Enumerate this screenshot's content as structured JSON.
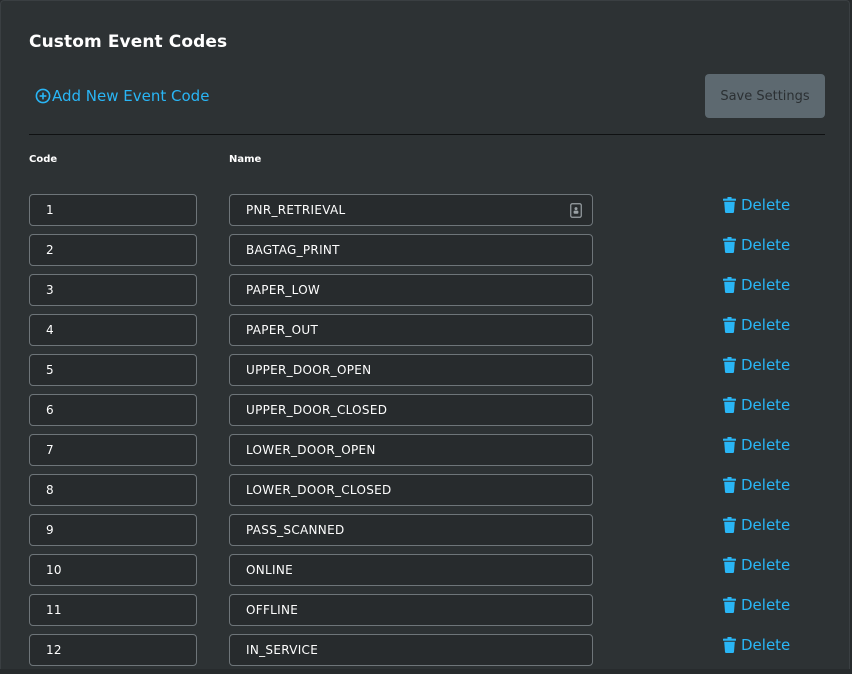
{
  "header": {
    "title": "Custom Event Codes",
    "add_label": "Add New Event Code",
    "save_label": "Save Settings"
  },
  "columns": {
    "code": "Code",
    "name": "Name"
  },
  "delete_label": "Delete",
  "colors": {
    "accent": "#29b6f6",
    "background": "#2d3234",
    "field_background": "#272b2d",
    "field_border": "#6e7579",
    "button_disabled": "#5d6970"
  },
  "icons": {
    "add": "plus-circle-icon",
    "delete": "trash-icon",
    "autofill": "contact-card-icon"
  },
  "rows": [
    {
      "code": "1",
      "name": "PNR_RETRIEVAL"
    },
    {
      "code": "2",
      "name": "BAGTAG_PRINT"
    },
    {
      "code": "3",
      "name": "PAPER_LOW"
    },
    {
      "code": "4",
      "name": "PAPER_OUT"
    },
    {
      "code": "5",
      "name": "UPPER_DOOR_OPEN"
    },
    {
      "code": "6",
      "name": "UPPER_DOOR_CLOSED"
    },
    {
      "code": "7",
      "name": "LOWER_DOOR_OPEN"
    },
    {
      "code": "8",
      "name": "LOWER_DOOR_CLOSED"
    },
    {
      "code": "9",
      "name": "PASS_SCANNED"
    },
    {
      "code": "10",
      "name": "ONLINE"
    },
    {
      "code": "11",
      "name": "OFFLINE"
    },
    {
      "code": "12",
      "name": "IN_SERVICE"
    }
  ]
}
